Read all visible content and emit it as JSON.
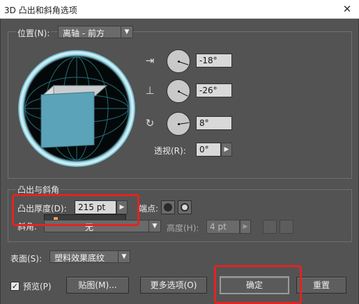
{
  "window": {
    "title": "3D 凸出和斜角选项",
    "close_glyph": "✕"
  },
  "position": {
    "label": "位置(N):",
    "preset": "离轴 - 前方",
    "x_rotation": "-18°",
    "y_rotation": "-26°",
    "z_rotation": "8°",
    "perspective_label": "透视(R):",
    "perspective": "0°"
  },
  "extrude": {
    "section_label": "凸出与斜角",
    "depth_label": "凸出厚度(D):",
    "depth": "215 pt",
    "cap_label": "端点:",
    "bevel_label": "斜角:",
    "bevel_value": "无",
    "height_label": "高度(H):",
    "height": "4 pt"
  },
  "surface": {
    "label": "表面(S):",
    "value": "塑料效果底纹"
  },
  "footer": {
    "preview_label": "预览(P)",
    "preview_checked": true,
    "map_button": "贴图(M)...",
    "more_button": "更多选项(O)",
    "ok_button": "确定",
    "reset_button": "重置"
  },
  "colors": {
    "dialog_bg": "#535353",
    "cube_front": "#5ba3b8",
    "cube_side": "#c9cdd0",
    "highlight": "#e02424"
  },
  "icons": {
    "x_axis": "rotate-x-icon",
    "y_axis": "rotate-y-icon",
    "z_axis": "rotate-z-icon",
    "dropdown": "chevron-down-icon",
    "stepper": "chevron-right-icon"
  }
}
